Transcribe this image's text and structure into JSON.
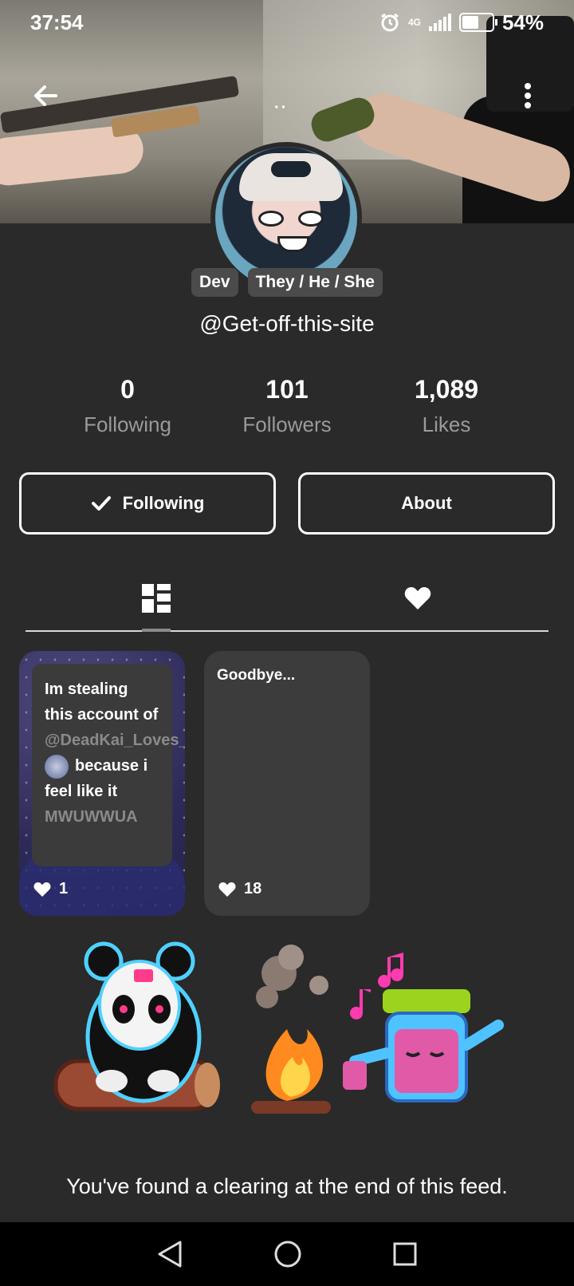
{
  "status_bar": {
    "time": "37:54",
    "network": "4G",
    "battery": "54%"
  },
  "profile": {
    "badges": [
      "Dev",
      "They / He / She"
    ],
    "handle": "@Get-off-this-site",
    "stats": [
      {
        "value": "0",
        "label": "Following"
      },
      {
        "value": "101",
        "label": "Followers"
      },
      {
        "value": "1,089",
        "label": "Likes"
      }
    ]
  },
  "actions": {
    "following_label": "Following",
    "about_label": "About"
  },
  "tabs": {
    "posts_icon": "grid-icon",
    "likes_icon": "heart-icon"
  },
  "posts": [
    {
      "text_parts": [
        "Im stealing this account of",
        "@DeadKai_Loves_Zip",
        "because i feel like it",
        "MWUWWUA"
      ],
      "likes": "1"
    },
    {
      "title": "Goodbye...",
      "likes": "18"
    }
  ],
  "footer": {
    "message": "You've found a clearing at the end of this feed."
  },
  "colors": {
    "background": "#2a2a2a",
    "card_dark": "#3c3c3c",
    "muted_text": "#9a9a9a"
  }
}
